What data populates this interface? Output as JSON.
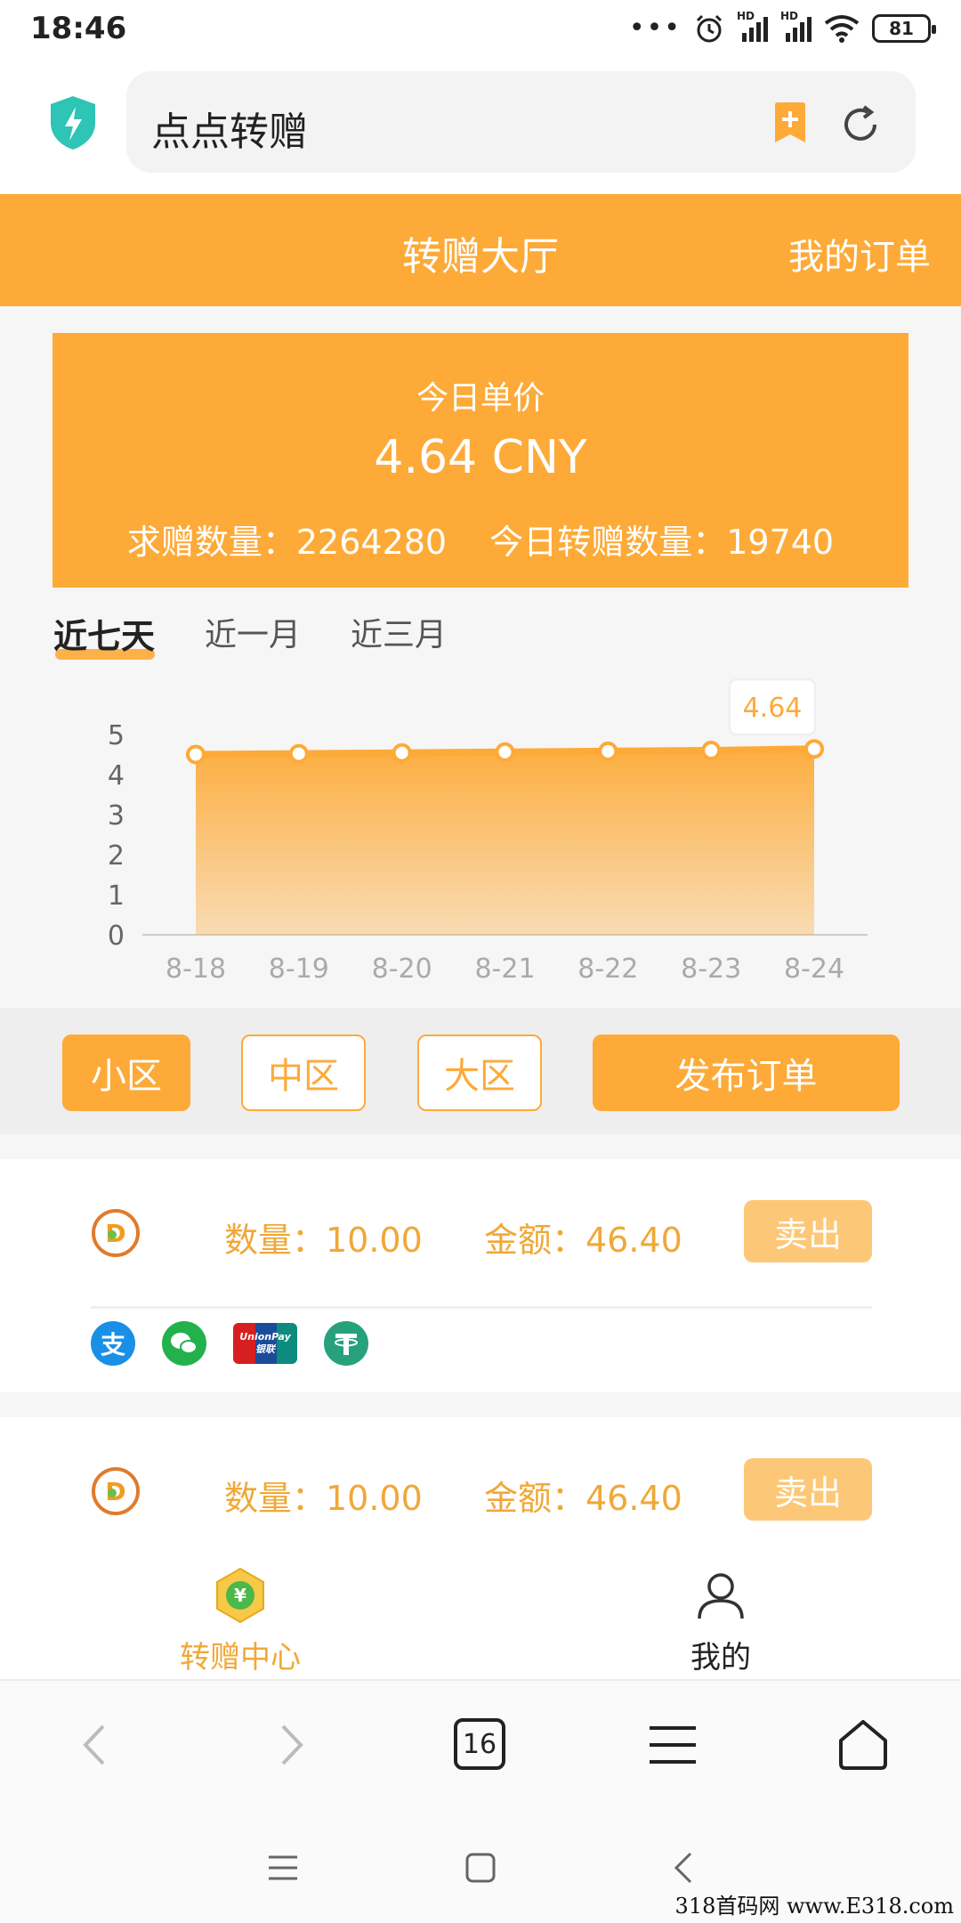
{
  "status_bar": {
    "time": "18:46",
    "signal_label": "HD",
    "battery": "81"
  },
  "address_bar": {
    "url_text": "点点转赠"
  },
  "header": {
    "title": "转赠大厅",
    "my_orders": "我的订单"
  },
  "price_card": {
    "label": "今日单价",
    "value": "4.64 CNY",
    "request_count": "求赠数量：2264280",
    "today_count": "今日转赠数量：19740"
  },
  "range_tabs": [
    {
      "label": "近七天",
      "active": true
    },
    {
      "label": "近一月",
      "active": false
    },
    {
      "label": "近三月",
      "active": false
    }
  ],
  "chart_data": {
    "type": "area",
    "x": [
      "8-18",
      "8-19",
      "8-20",
      "8-21",
      "8-22",
      "8-23",
      "8-24"
    ],
    "values": [
      4.5,
      4.52,
      4.54,
      4.56,
      4.58,
      4.6,
      4.64
    ],
    "ylim": [
      0,
      5
    ],
    "yticks": [
      "0",
      "1",
      "2",
      "3",
      "4",
      "5"
    ],
    "tooltip": "4.64",
    "color": "#fdaa38"
  },
  "filters": {
    "small": "小区",
    "medium": "中区",
    "large": "大区",
    "publish": "发布订单"
  },
  "orders": [
    {
      "qty": "数量：10.00",
      "amount": "金额：46.40",
      "sell": "卖出"
    },
    {
      "qty": "数量：10.00",
      "amount": "金额：46.40",
      "sell": "卖出"
    }
  ],
  "payments": {
    "alipay": "支",
    "unionpay_top": "UnionPay",
    "unionpay_bottom": "银联"
  },
  "app_tabs": {
    "center": "转赠中心",
    "coin": "¥",
    "mine": "我的"
  },
  "browser_bar": {
    "tab_count": "16"
  },
  "watermark": "318首码网  www.E318.com"
}
